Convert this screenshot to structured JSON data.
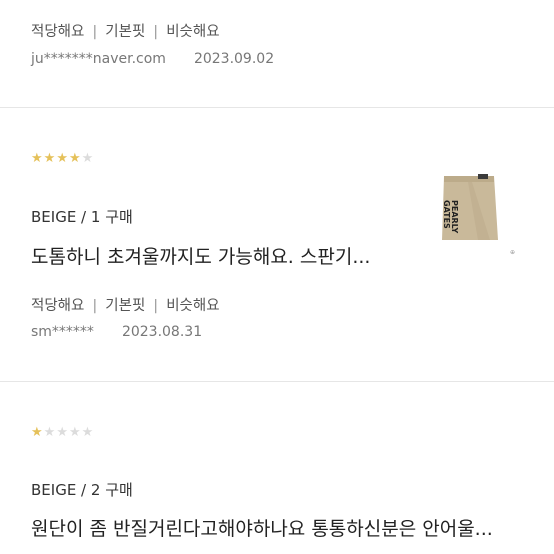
{
  "review1": {
    "tags": [
      "적당해요",
      "기본핏",
      "비슷해요"
    ],
    "user": "ju*******naver.com",
    "date": "2023.09.02"
  },
  "review2": {
    "rating": 4,
    "option": "BEIGE / 1 구매",
    "text": "도톰하니 초겨울까지도 가능해요. 스판기...",
    "tags": [
      "적당해요",
      "기본핏",
      "비슷해요"
    ],
    "user": "sm******",
    "date": "2023.08.31",
    "thumb_label": "PEARLY GATES"
  },
  "review3": {
    "rating": 1,
    "option": "BEIGE / 2 구매",
    "text": "원단이 좀 반질거린다고해야하나요 통통하신분은 안어울..."
  },
  "colors": {
    "star": "#e5c15a",
    "star_empty": "#dcdcdc",
    "skirt": "#c9b99a"
  }
}
